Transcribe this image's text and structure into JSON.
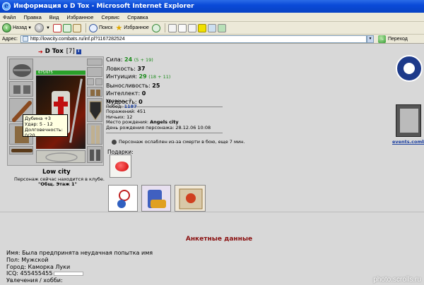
{
  "window": {
    "title": "Информация о D Tox - Microsoft Internet Explorer"
  },
  "menu": [
    "Файл",
    "Правка",
    "Вид",
    "Избранное",
    "Сервис",
    "Справка"
  ],
  "toolbar": {
    "back": "Назад",
    "search": "Поиск",
    "favorites": "Избранное"
  },
  "address": {
    "label": "Адрес:",
    "url": "http://lowcity.combats.ru/inf.pl?1167282524",
    "go": "Переход"
  },
  "character": {
    "name": "D Tox",
    "level": "[7]",
    "hp": "675/675",
    "city": "Low city",
    "location_line": "Персонаж сейчас находится в клубе.",
    "location_room": "\"Общ. Этаж 1\""
  },
  "tooltip": {
    "line1": "Дубина +3",
    "line2": "Удар: 5 - 12",
    "line3": "Долговечность: 0/20"
  },
  "stats": [
    {
      "label": "Сила:",
      "value": "24",
      "note": "(5 + 19)",
      "highlight": true
    },
    {
      "label": "Ловкость:",
      "value": "37",
      "note": "",
      "highlight": false
    },
    {
      "label": "Интуиция:",
      "value": "29",
      "note": "(18 + 11)",
      "highlight": true
    },
    {
      "label": "Выносливость:",
      "value": "25",
      "note": "",
      "highlight": false
    },
    {
      "label": "Интеллект:",
      "value": "0",
      "note": "",
      "highlight": false
    },
    {
      "label": "Мудрость:",
      "value": "0",
      "note": "",
      "highlight": false
    }
  ],
  "info": {
    "level_label": "Уровень:",
    "level_value": "7",
    "wins_label": "Побед:",
    "wins_value": "1187",
    "losses_label": "Поражений:",
    "losses_value": "451",
    "draws_label": "Ничьих:",
    "draws_value": "12",
    "birthplace_label": "Место рождения:",
    "birthplace_value": "Angels city",
    "birthday_label": "День рождения персонажа:",
    "birthday_value": "28.12.06 10:08"
  },
  "weakened": "Персонаж ослаблен из-за смерти в бою, еще 7 мин.",
  "gifts_label": "Подарки:",
  "events_link": "events.combats",
  "anketa": {
    "title": "Анкетные данные",
    "name_line": "Имя: Была предпринята неудачная попытка имя",
    "gender_line": "Пол: Мужской",
    "city_line": "Город: Каморка Луки",
    "icq_line": "ICQ: 455455455",
    "hobby_line": "Увлечения / хобби:"
  },
  "watermark": "photo.scrolls.ru",
  "colors": {
    "stat_green": "#1a8a1a",
    "link_blue": "#1b3fa0",
    "heading_red": "#8a1010",
    "titlebar_blue": "#0a4ad8"
  }
}
